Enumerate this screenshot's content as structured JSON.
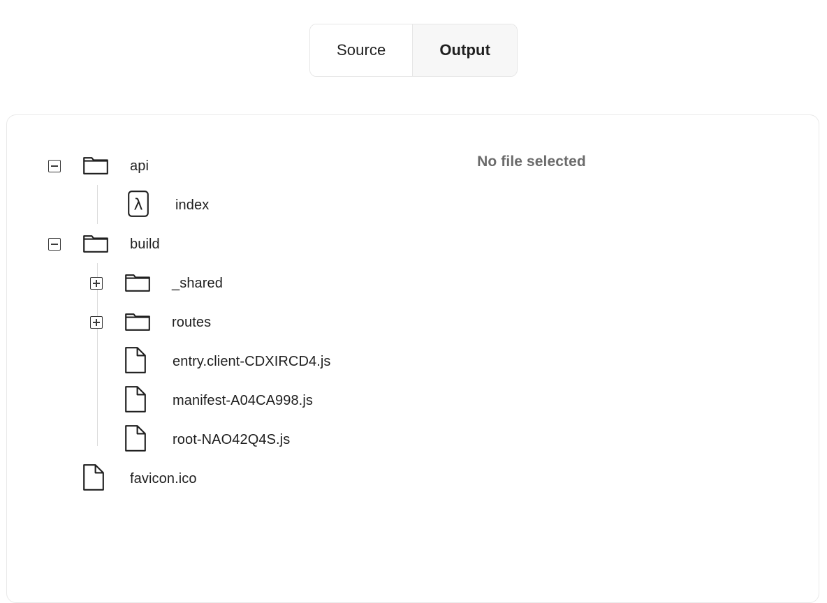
{
  "tabs": {
    "items": [
      {
        "label": "Source",
        "active": false
      },
      {
        "label": "Output",
        "active": true
      }
    ]
  },
  "empty_state": {
    "message": "No file selected"
  },
  "tree": {
    "rows": [
      {
        "name": "api",
        "type": "folder",
        "toggle": "minus",
        "depth": 0,
        "icon": "folder-icon"
      },
      {
        "name": "index",
        "type": "lambda",
        "toggle": "none",
        "depth": 1,
        "icon": "lambda-icon"
      },
      {
        "name": "build",
        "type": "folder",
        "toggle": "minus",
        "depth": 0,
        "icon": "folder-icon"
      },
      {
        "name": "_shared",
        "type": "folder",
        "toggle": "plus",
        "depth": 1,
        "icon": "folder-icon"
      },
      {
        "name": "routes",
        "type": "folder",
        "toggle": "plus",
        "depth": 1,
        "icon": "folder-icon"
      },
      {
        "name": "entry.client-CDXIRCD4.js",
        "type": "file",
        "toggle": "none",
        "depth": 1,
        "icon": "file-icon"
      },
      {
        "name": "manifest-A04CA998.js",
        "type": "file",
        "toggle": "none",
        "depth": 1,
        "icon": "file-icon"
      },
      {
        "name": "root-NAO42Q4S.js",
        "type": "file",
        "toggle": "none",
        "depth": 1,
        "icon": "file-icon"
      },
      {
        "name": "favicon.ico",
        "type": "file",
        "toggle": "none",
        "depth": 0,
        "icon": "file-icon"
      }
    ]
  },
  "colors": {
    "border": "#e9e9e9",
    "tab_active_bg": "#f7f7f7",
    "guide_line": "#dcdcdc",
    "icon_stroke": "#1f1f1f",
    "muted_text": "#6b6b6b"
  }
}
